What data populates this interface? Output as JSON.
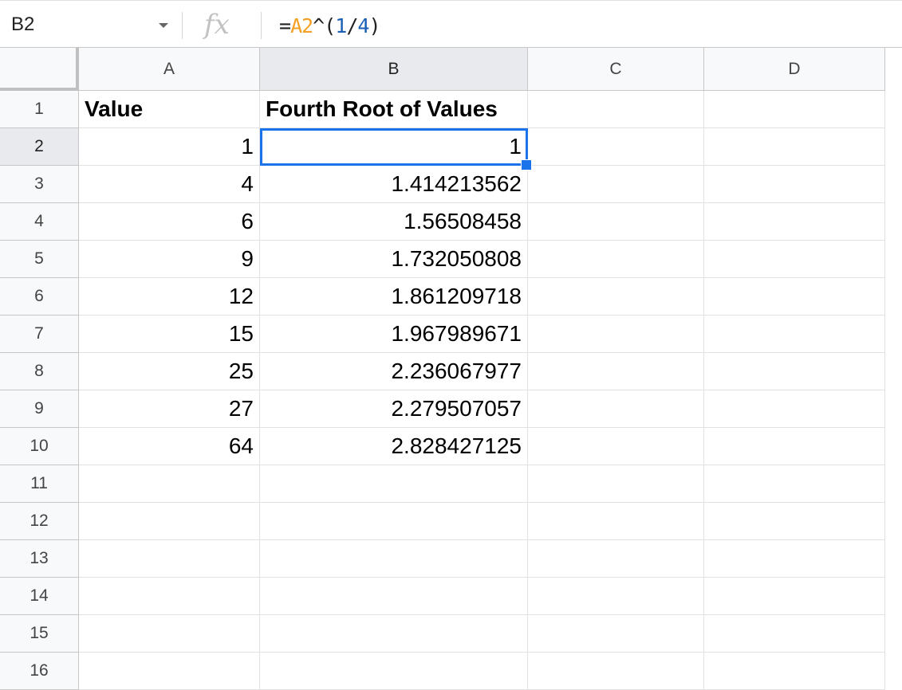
{
  "formula_bar": {
    "name_box": "B2",
    "fx_label": "fx",
    "formula_parts": [
      {
        "text": "=",
        "kind": "plain"
      },
      {
        "text": "A2",
        "kind": "ref"
      },
      {
        "text": "^(",
        "kind": "plain"
      },
      {
        "text": "1",
        "kind": "num"
      },
      {
        "text": "/",
        "kind": "plain"
      },
      {
        "text": "4",
        "kind": "num"
      },
      {
        "text": ")",
        "kind": "plain"
      }
    ]
  },
  "columns": [
    "A",
    "B",
    "C",
    "D"
  ],
  "selected_column": "B",
  "row_numbers": [
    "1",
    "2",
    "3",
    "4",
    "5",
    "6",
    "7",
    "8",
    "9",
    "10",
    "11",
    "12",
    "13",
    "14",
    "15",
    "16"
  ],
  "selected_row": "2",
  "rows": [
    {
      "a": "Value",
      "b": "Fourth Root of Values",
      "header": true
    },
    {
      "a": "1",
      "b": "1"
    },
    {
      "a": "4",
      "b": "1.414213562"
    },
    {
      "a": "6",
      "b": "1.56508458"
    },
    {
      "a": "9",
      "b": "1.732050808"
    },
    {
      "a": "12",
      "b": "1.861209718"
    },
    {
      "a": "15",
      "b": "1.967989671"
    },
    {
      "a": "25",
      "b": "2.236067977"
    },
    {
      "a": "27",
      "b": "2.279507057"
    },
    {
      "a": "64",
      "b": "2.828427125"
    },
    {
      "a": "",
      "b": ""
    },
    {
      "a": "",
      "b": ""
    },
    {
      "a": "",
      "b": ""
    },
    {
      "a": "",
      "b": ""
    },
    {
      "a": "",
      "b": ""
    },
    {
      "a": "",
      "b": ""
    }
  ],
  "colors": {
    "selection": "#1a73e8",
    "formula_ref": "#f4a024",
    "formula_number": "#1a5fb4"
  }
}
